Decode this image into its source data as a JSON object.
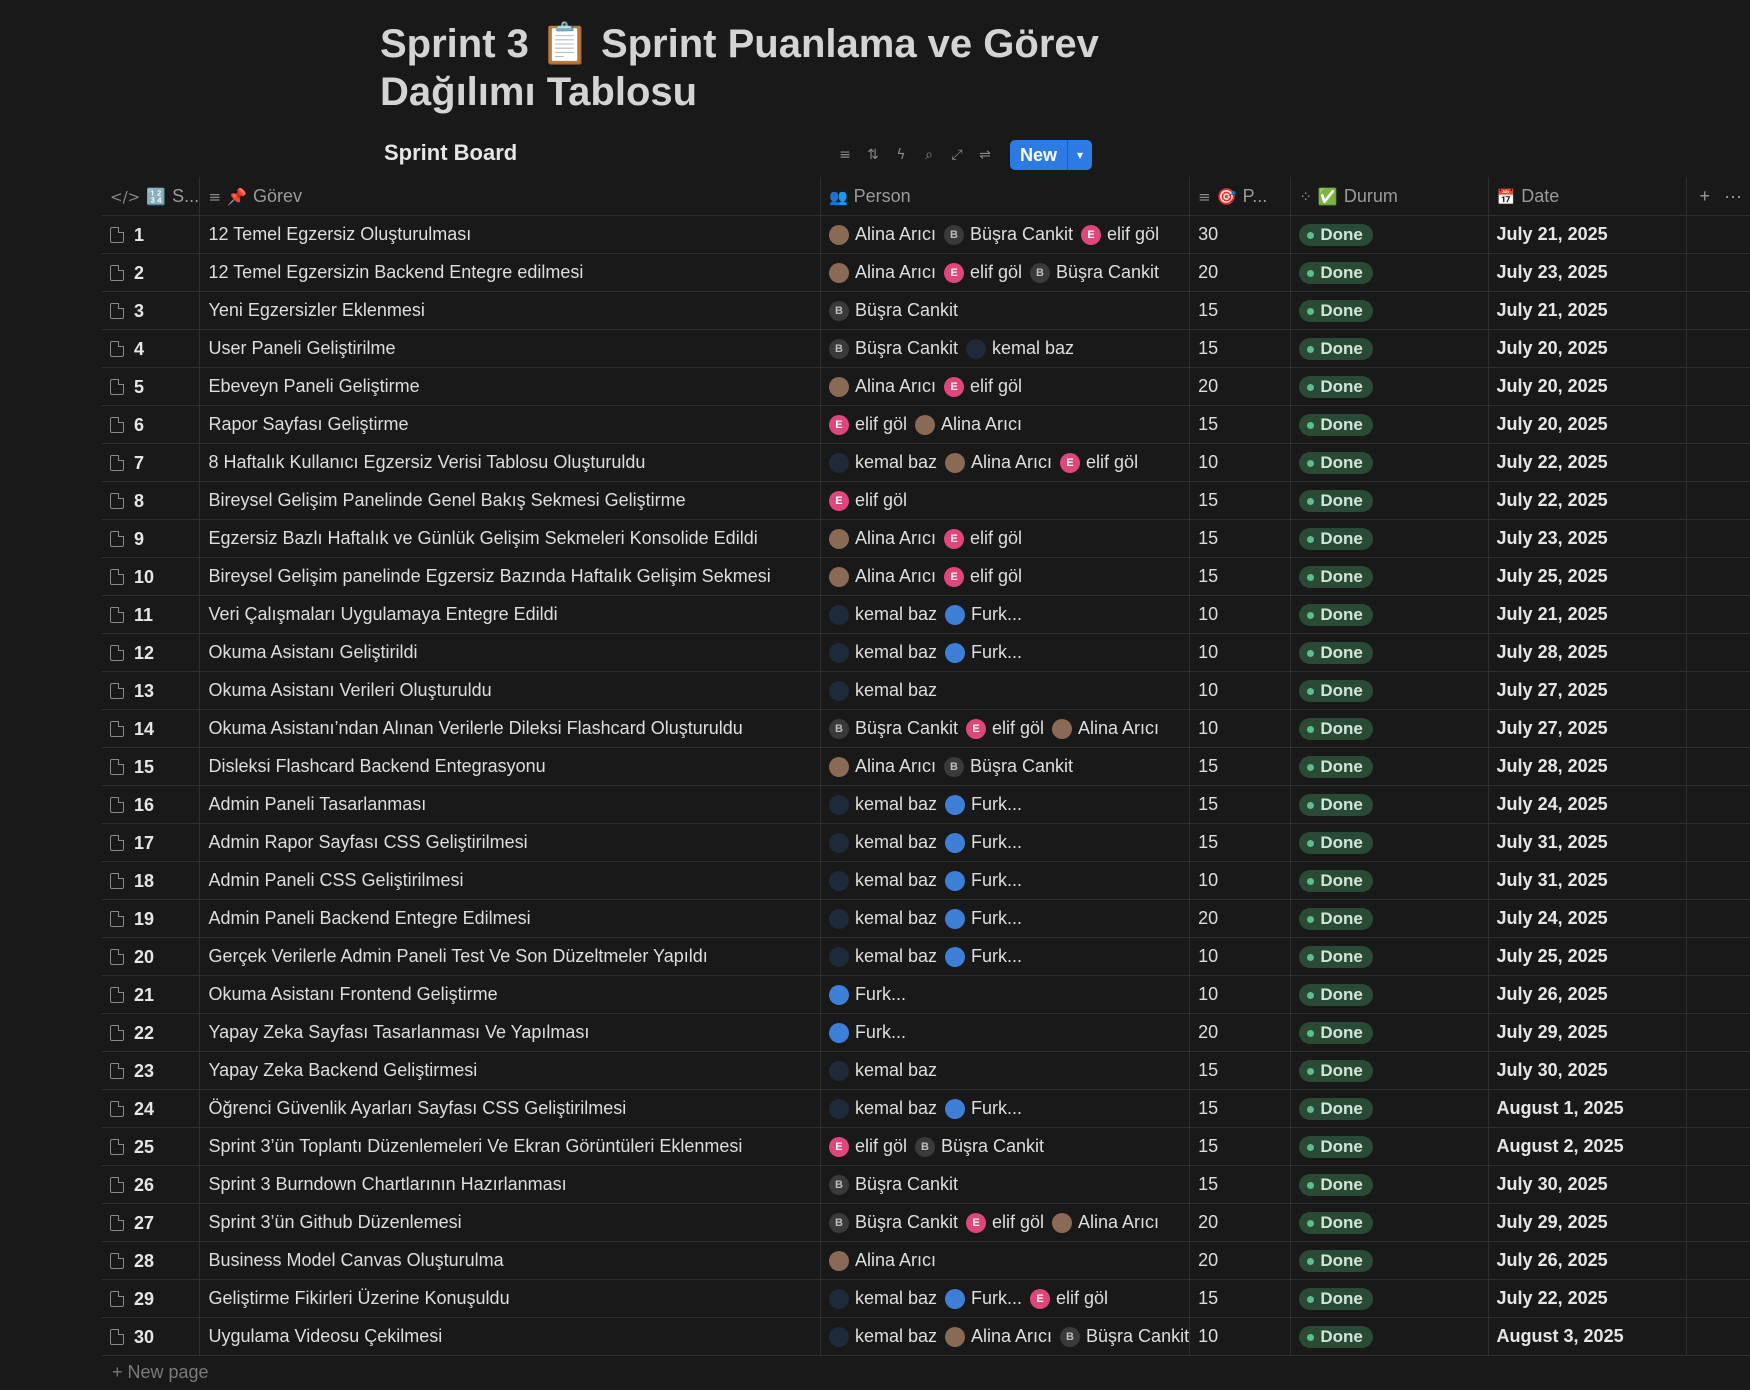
{
  "page": {
    "title": "Sprint 3 📋 Sprint Puanlama ve Görev Dağılımı Tablosu",
    "view_name": "Sprint Board",
    "new_button_label": "New",
    "new_page_label": "+ New page"
  },
  "toolbar_icons": [
    "filter-icon",
    "sort-icon",
    "automation-icon",
    "search-icon",
    "expand-icon",
    "settings-icon"
  ],
  "columns": {
    "sno": {
      "icon": "</>",
      "emoji": "🔢",
      "label": "S..."
    },
    "task": {
      "icon": "≡",
      "emoji": "📌",
      "label": "Görev"
    },
    "person": {
      "icon": "👥",
      "label": "Person"
    },
    "points": {
      "icon": "≡",
      "emoji": "🎯",
      "label": "P..."
    },
    "status": {
      "icon": "⁘",
      "emoji": "✅",
      "label": "Durum"
    },
    "date": {
      "icon": "📅",
      "label": "Date"
    },
    "add": "+",
    "more": "···"
  },
  "colors": {
    "accent": "#2c7be5",
    "status_bg": "#2b4a36",
    "status_dot": "#5ac08a"
  },
  "rows": [
    {
      "n": "1",
      "task": "12 Temel Egzersiz Oluşturulması",
      "people": [
        {
          "name": "Alina Arıcı",
          "av": "a"
        },
        {
          "name": "Büşra Cankit",
          "av": "b"
        },
        {
          "name": "elif göl",
          "av": "e"
        }
      ],
      "points": "30",
      "status": "Done",
      "date": "July 21, 2025"
    },
    {
      "n": "2",
      "task": "12 Temel Egzersizin Backend Entegre edilmesi",
      "people": [
        {
          "name": "Alina Arıcı",
          "av": "a"
        },
        {
          "name": "elif göl",
          "av": "e"
        },
        {
          "name": "Büşra Cankit",
          "av": "b"
        }
      ],
      "points": "20",
      "status": "Done",
      "date": "July 23, 2025"
    },
    {
      "n": "3",
      "task": "Yeni Egzersizler Eklenmesi",
      "people": [
        {
          "name": "Büşra Cankit",
          "av": "b"
        }
      ],
      "points": "15",
      "status": "Done",
      "date": "July 21, 2025"
    },
    {
      "n": "4",
      "task": "User Paneli Geliştirilme",
      "people": [
        {
          "name": "Büşra Cankit",
          "av": "b"
        },
        {
          "name": "kemal baz",
          "av": "k"
        }
      ],
      "points": "15",
      "status": "Done",
      "date": "July 20, 2025"
    },
    {
      "n": "5",
      "task": "Ebeveyn Paneli Geliştirme",
      "people": [
        {
          "name": "Alina Arıcı",
          "av": "a"
        },
        {
          "name": "elif göl",
          "av": "e"
        }
      ],
      "points": "20",
      "status": "Done",
      "date": "July 20, 2025"
    },
    {
      "n": "6",
      "task": "Rapor Sayfası Geliştirme",
      "people": [
        {
          "name": "elif göl",
          "av": "e"
        },
        {
          "name": "Alina Arıcı",
          "av": "a"
        }
      ],
      "points": "15",
      "status": "Done",
      "date": "July 20, 2025"
    },
    {
      "n": "7",
      "task": "8 Haftalık Kullanıcı Egzersiz Verisi Tablosu Oluşturuldu",
      "people": [
        {
          "name": "kemal baz",
          "av": "k"
        },
        {
          "name": "Alina Arıcı",
          "av": "a"
        },
        {
          "name": "elif göl",
          "av": "e"
        }
      ],
      "points": "10",
      "status": "Done",
      "date": "July 22, 2025"
    },
    {
      "n": "8",
      "task": "Bireysel Gelişim Panelinde Genel Bakış Sekmesi Geliştirme",
      "people": [
        {
          "name": "elif göl",
          "av": "e"
        }
      ],
      "points": "15",
      "status": "Done",
      "date": "July 22, 2025"
    },
    {
      "n": "9",
      "task": "Egzersiz Bazlı Haftalık ve Günlük Gelişim Sekmeleri Konsolide Edildi",
      "people": [
        {
          "name": "Alina Arıcı",
          "av": "a"
        },
        {
          "name": "elif göl",
          "av": "e"
        }
      ],
      "points": "15",
      "status": "Done",
      "date": "July 23, 2025"
    },
    {
      "n": "10",
      "task": "Bireysel Gelişim panelinde Egzersiz Bazında Haftalık Gelişim Sekmesi",
      "people": [
        {
          "name": "Alina Arıcı",
          "av": "a"
        },
        {
          "name": "elif göl",
          "av": "e"
        }
      ],
      "points": "15",
      "status": "Done",
      "date": "July 25, 2025"
    },
    {
      "n": "11",
      "task": "Veri Çalışmaları Uygulamaya Entegre Edildi",
      "people": [
        {
          "name": "kemal baz",
          "av": "k"
        },
        {
          "name": "Furk...",
          "av": "f"
        }
      ],
      "points": "10",
      "status": "Done",
      "date": "July 21, 2025"
    },
    {
      "n": "12",
      "task": "Okuma Asistanı Geliştirildi",
      "people": [
        {
          "name": "kemal baz",
          "av": "k"
        },
        {
          "name": "Furk...",
          "av": "f"
        }
      ],
      "points": "10",
      "status": "Done",
      "date": "July 28, 2025"
    },
    {
      "n": "13",
      "task": "Okuma Asistanı Verileri Oluşturuldu",
      "people": [
        {
          "name": "kemal baz",
          "av": "k"
        }
      ],
      "points": "10",
      "status": "Done",
      "date": "July 27, 2025"
    },
    {
      "n": "14",
      "task": "Okuma Asistanı’ndan Alınan Verilerle Dileksi Flashcard Oluşturuldu",
      "people": [
        {
          "name": "Büşra Cankit",
          "av": "b"
        },
        {
          "name": "elif göl",
          "av": "e"
        },
        {
          "name": "Alina Arıcı",
          "av": "a"
        }
      ],
      "points": "10",
      "status": "Done",
      "date": "July 27, 2025"
    },
    {
      "n": "15",
      "task": "Disleksi Flashcard Backend Entegrasyonu",
      "people": [
        {
          "name": "Alina Arıcı",
          "av": "a"
        },
        {
          "name": "Büşra Cankit",
          "av": "b"
        }
      ],
      "points": "15",
      "status": "Done",
      "date": "July 28, 2025"
    },
    {
      "n": "16",
      "task": "Admin Paneli Tasarlanması",
      "people": [
        {
          "name": "kemal baz",
          "av": "k"
        },
        {
          "name": "Furk...",
          "av": "f"
        }
      ],
      "points": "15",
      "status": "Done",
      "date": "July 24, 2025"
    },
    {
      "n": "17",
      "task": "Admin Rapor Sayfası CSS Geliştirilmesi",
      "people": [
        {
          "name": "kemal baz",
          "av": "k"
        },
        {
          "name": "Furk...",
          "av": "f"
        }
      ],
      "points": "15",
      "status": "Done",
      "date": "July 31, 2025"
    },
    {
      "n": "18",
      "task": "Admin Paneli CSS Geliştirilmesi",
      "people": [
        {
          "name": "kemal baz",
          "av": "k"
        },
        {
          "name": "Furk...",
          "av": "f"
        }
      ],
      "points": "10",
      "status": "Done",
      "date": "July 31, 2025"
    },
    {
      "n": "19",
      "task": "Admin Paneli Backend Entegre Edilmesi",
      "people": [
        {
          "name": "kemal baz",
          "av": "k"
        },
        {
          "name": "Furk...",
          "av": "f"
        }
      ],
      "points": "20",
      "status": "Done",
      "date": "July 24, 2025"
    },
    {
      "n": "20",
      "task": "Gerçek Verilerle Admin Paneli Test Ve Son Düzeltmeler Yapıldı",
      "people": [
        {
          "name": "kemal baz",
          "av": "k"
        },
        {
          "name": "Furk...",
          "av": "f"
        }
      ],
      "points": "10",
      "status": "Done",
      "date": "July 25, 2025"
    },
    {
      "n": "21",
      "task": "Okuma Asistanı Frontend Geliştirme",
      "people": [
        {
          "name": "Furk...",
          "av": "f"
        }
      ],
      "points": "10",
      "status": "Done",
      "date": "July 26, 2025"
    },
    {
      "n": "22",
      "task": "Yapay Zeka Sayfası Tasarlanması Ve Yapılması",
      "people": [
        {
          "name": "Furk...",
          "av": "f"
        }
      ],
      "points": "20",
      "status": "Done",
      "date": "July 29, 2025"
    },
    {
      "n": "23",
      "task": "Yapay Zeka Backend Geliştirmesi",
      "people": [
        {
          "name": "kemal baz",
          "av": "k"
        }
      ],
      "points": "15",
      "status": "Done",
      "date": "July 30, 2025"
    },
    {
      "n": "24",
      "task": "Öğrenci Güvenlik Ayarları Sayfası CSS Geliştirilmesi",
      "people": [
        {
          "name": "kemal baz",
          "av": "k"
        },
        {
          "name": "Furk...",
          "av": "f"
        }
      ],
      "points": "15",
      "status": "Done",
      "date": "August 1, 2025"
    },
    {
      "n": "25",
      "task": "Sprint 3’ün Toplantı Düzenlemeleri Ve Ekran Görüntüleri Eklenmesi",
      "people": [
        {
          "name": "elif göl",
          "av": "e"
        },
        {
          "name": "Büşra Cankit",
          "av": "b"
        }
      ],
      "points": "15",
      "status": "Done",
      "date": "August 2, 2025"
    },
    {
      "n": "26",
      "task": "Sprint 3 Burndown Chartlarının Hazırlanması",
      "people": [
        {
          "name": "Büşra Cankit",
          "av": "b"
        }
      ],
      "points": "15",
      "status": "Done",
      "date": "July 30, 2025"
    },
    {
      "n": "27",
      "task": "Sprint 3’ün Github Düzenlemesi",
      "people": [
        {
          "name": "Büşra Cankit",
          "av": "b"
        },
        {
          "name": "elif göl",
          "av": "e"
        },
        {
          "name": "Alina Arıcı",
          "av": "a"
        }
      ],
      "points": "20",
      "status": "Done",
      "date": "July 29, 2025"
    },
    {
      "n": "28",
      "task": "Business Model Canvas Oluşturulma",
      "people": [
        {
          "name": "Alina Arıcı",
          "av": "a"
        }
      ],
      "points": "20",
      "status": "Done",
      "date": "July 26, 2025"
    },
    {
      "n": "29",
      "task": "Geliştirme Fikirleri Üzerine Konuşuldu",
      "people": [
        {
          "name": "kemal baz",
          "av": "k"
        },
        {
          "name": "Furk...",
          "av": "f"
        },
        {
          "name": "elif göl",
          "av": "e"
        }
      ],
      "points": "15",
      "status": "Done",
      "date": "July 22, 2025"
    },
    {
      "n": "30",
      "task": "Uygulama Videosu Çekilmesi",
      "people": [
        {
          "name": "kemal baz",
          "av": "k"
        },
        {
          "name": "Alina Arıcı",
          "av": "a"
        },
        {
          "name": "Büşra Cankit",
          "av": "b"
        }
      ],
      "points": "10",
      "status": "Done",
      "date": "August 3, 2025"
    }
  ]
}
